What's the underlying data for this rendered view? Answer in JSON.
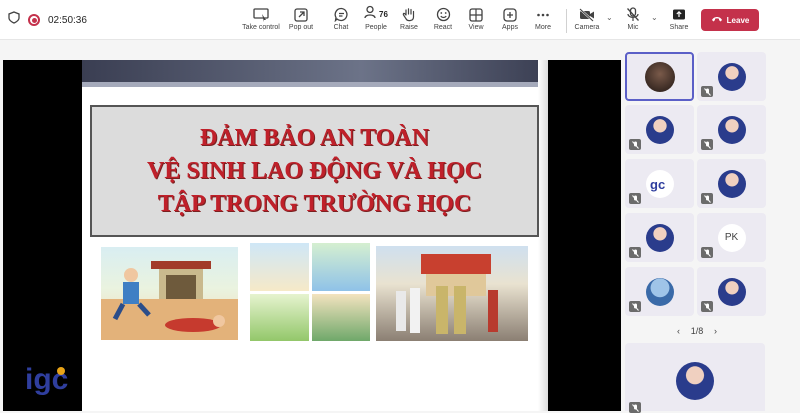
{
  "status": {
    "timer": "02:50:36"
  },
  "toolbar": {
    "take_control": "Take control",
    "pop_out": "Pop out",
    "chat": "Chat",
    "people": "People",
    "people_count": "76",
    "raise": "Raise",
    "react": "React",
    "view": "View",
    "apps": "Apps",
    "more": "More",
    "camera": "Camera",
    "mic": "Mic",
    "share": "Share",
    "leave": "Leave"
  },
  "slide": {
    "title_line1": "ĐẢM BẢO AN TOÀN",
    "title_line2": "VỆ SINH LAO ĐỘNG VÀ HỌC",
    "title_line3": "TẬP TRONG TRƯỜNG HỌC"
  },
  "participants": {
    "initials": "PK",
    "page_indicator": "1/8"
  },
  "colors": {
    "leave": "#c4314b",
    "accent": "#5b5fc7",
    "slide_title": "#c0202a"
  }
}
